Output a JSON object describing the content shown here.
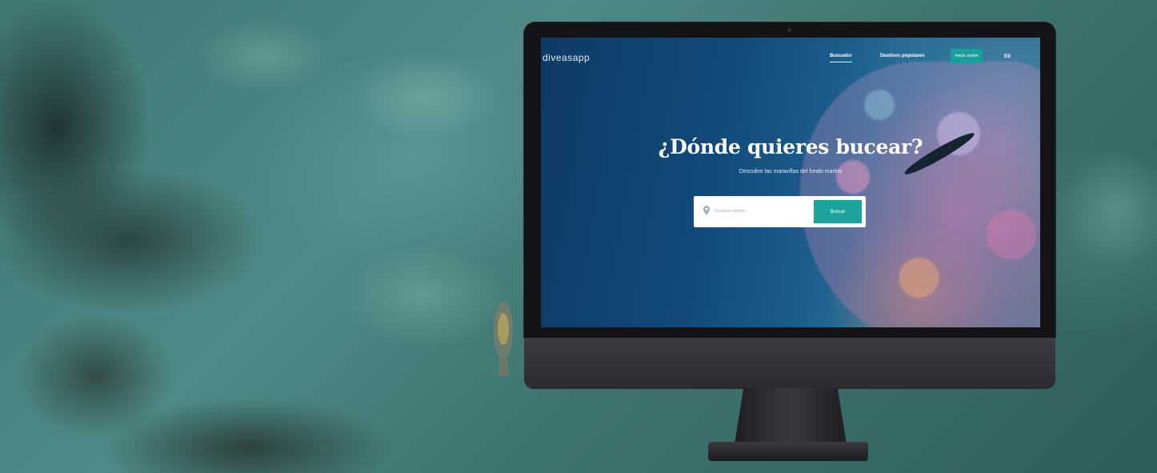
{
  "site": {
    "logo": "diveasapp",
    "nav": {
      "links": [
        "Buscador",
        "Destinos populares"
      ],
      "cta": "Iniciar sesión",
      "lang": "ES"
    },
    "hero": {
      "title": "¿Dónde quieres bucear?",
      "subtitle": "Descubre las maravillas del fondo marino"
    },
    "search": {
      "placeholder": "Introduce destino",
      "button": "Buscar"
    }
  },
  "colors": {
    "accent": "#1ba39c",
    "screen_water": "#124a7a",
    "monitor": "#141416"
  },
  "icons": [
    "location-pin-icon"
  ]
}
